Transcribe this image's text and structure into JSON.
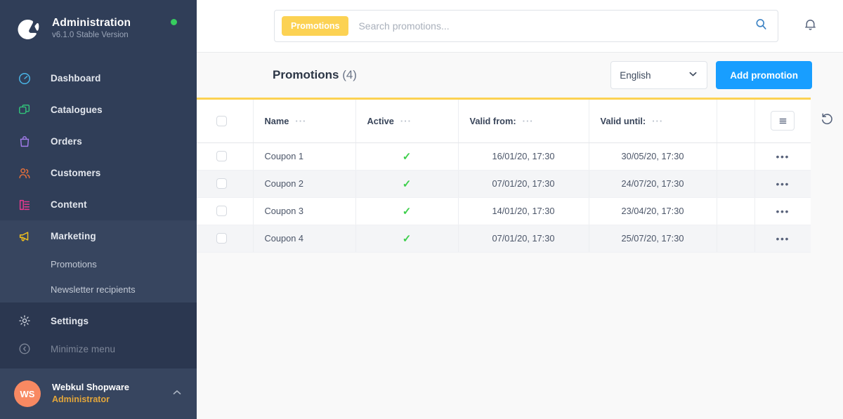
{
  "sidebar": {
    "brand": {
      "logo_icon": "shopware-logo-icon",
      "title": "Administration",
      "version": "v6.1.0 Stable Version",
      "status_color": "#37cd5f"
    },
    "items": [
      {
        "label": "Dashboard",
        "icon": "dashboard-gauge-icon",
        "color": "#4ab6e8"
      },
      {
        "label": "Catalogues",
        "icon": "catalogues-layers-icon",
        "color": "#32c27a"
      },
      {
        "label": "Orders",
        "icon": "orders-bag-icon",
        "color": "#a07be8"
      },
      {
        "label": "Customers",
        "icon": "customers-people-icon",
        "color": "#e8703a"
      },
      {
        "label": "Content",
        "icon": "content-document-icon",
        "color": "#e8398f"
      },
      {
        "label": "Marketing",
        "icon": "marketing-megaphone-icon",
        "color": "#f2c11c"
      }
    ],
    "marketing_children": [
      {
        "label": "Promotions"
      },
      {
        "label": "Newsletter recipients"
      }
    ],
    "settings": {
      "label": "Settings",
      "icon": "gear-icon"
    },
    "minimize": {
      "label": "Minimize menu",
      "icon": "chevron-left-circle-icon"
    },
    "user": {
      "initials": "WS",
      "name": "Webkul Shopware",
      "role": "Administrator",
      "chevron_icon": "chevron-up-icon",
      "avatar_color": "#f88962"
    }
  },
  "topbar": {
    "search_tag": "Promotions",
    "search_placeholder": "Search promotions...",
    "search_value": "",
    "search_icon": "search-icon",
    "bell_icon": "bell-icon"
  },
  "page": {
    "title": "Promotions",
    "count": "(4)",
    "language": "English",
    "language_chevron_icon": "chevron-down-icon",
    "add_button": "Add promotion",
    "accent_color": "#fcd253",
    "primary_color": "#189eff",
    "refresh_icon": "refresh-undo-icon"
  },
  "table": {
    "columns": [
      {
        "label": "Name",
        "dots": "···"
      },
      {
        "label": "Active",
        "dots": "···"
      },
      {
        "label": "Valid from:",
        "dots": "···"
      },
      {
        "label": "Valid until:",
        "dots": "···"
      }
    ],
    "settings_icon": "list-settings-icon",
    "row_menu_glyph": "•••",
    "active_glyph": "✓",
    "rows": [
      {
        "name": "Coupon 1",
        "active": "✓",
        "valid_from": "16/01/20, 17:30",
        "valid_until": "30/05/20, 17:30"
      },
      {
        "name": "Coupon 2",
        "active": "✓",
        "valid_from": "07/01/20, 17:30",
        "valid_until": "24/07/20, 17:30"
      },
      {
        "name": "Coupon 3",
        "active": "✓",
        "valid_from": "14/01/20, 17:30",
        "valid_until": "23/04/20, 17:30"
      },
      {
        "name": "Coupon 4",
        "active": "✓",
        "valid_from": "07/01/20, 17:30",
        "valid_until": "25/07/20, 17:30"
      }
    ]
  }
}
